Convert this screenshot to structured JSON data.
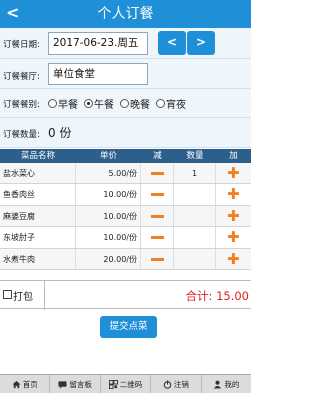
{
  "header": {
    "back": "<",
    "title": "个人订餐"
  },
  "form": {
    "date_label": "订餐日期:",
    "date_value": "2017-06-23.周五",
    "prev": "<",
    "next": ">",
    "canteen_label": "订餐餐厅:",
    "canteen_value": "单位食堂",
    "type_label": "订餐餐别:",
    "types": [
      "早餐",
      "午餐",
      "晚餐",
      "宵夜"
    ],
    "selected_type": "午餐",
    "qty_label": "订餐数量:",
    "qty_value": "0 份"
  },
  "table": {
    "headers": [
      "菜品名称",
      "单价",
      "减",
      "数量",
      "加"
    ],
    "rows": [
      {
        "name": "盐水菜心",
        "price": "5.00/份",
        "count": "1"
      },
      {
        "name": "鱼香肉丝",
        "price": "10.00/份",
        "count": ""
      },
      {
        "name": "麻婆豆腐",
        "price": "10.00/份",
        "count": ""
      },
      {
        "name": "东坡肘子",
        "price": "10.00/份",
        "count": ""
      },
      {
        "name": "水煮牛肉",
        "price": "20.00/份",
        "count": ""
      }
    ]
  },
  "pack": {
    "label": "打包",
    "total": "合计: 15.00"
  },
  "submit_label": "提交点菜",
  "nav": [
    {
      "label": "首页",
      "icon": "home-icon"
    },
    {
      "label": "留言板",
      "icon": "message-icon"
    },
    {
      "label": "二维码",
      "icon": "qrcode-icon"
    },
    {
      "label": "注销",
      "icon": "logout-icon"
    },
    {
      "label": "我的",
      "icon": "user-icon"
    }
  ],
  "colors": {
    "primary": "#1f8fd8",
    "table_header": "#2d5f8d",
    "accent": "#f08020",
    "total": "#e02020"
  }
}
